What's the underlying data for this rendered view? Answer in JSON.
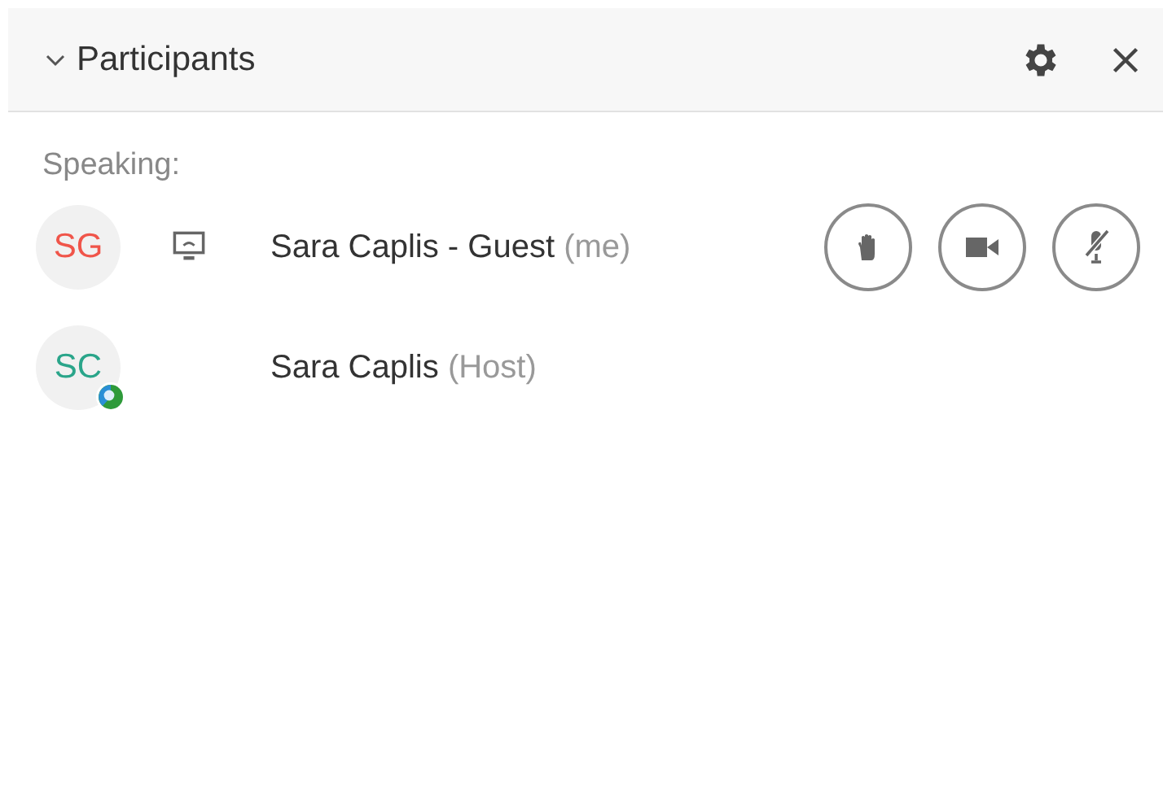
{
  "panel": {
    "title": "Participants",
    "expanded": true
  },
  "section_label": "Speaking:",
  "participants": [
    {
      "initials": "SG",
      "color": "#f0554a",
      "name": "Sara Caplis - Guest",
      "tag": "(me)",
      "screen_icon": true,
      "badge": false,
      "controls": [
        {
          "kind": "hand"
        },
        {
          "kind": "video"
        },
        {
          "kind": "mic",
          "muted": true
        }
      ]
    },
    {
      "initials": "SC",
      "color": "#2aa58a",
      "name": "Sara Caplis",
      "tag": "(Host)",
      "screen_icon": false,
      "badge": true
    }
  ]
}
